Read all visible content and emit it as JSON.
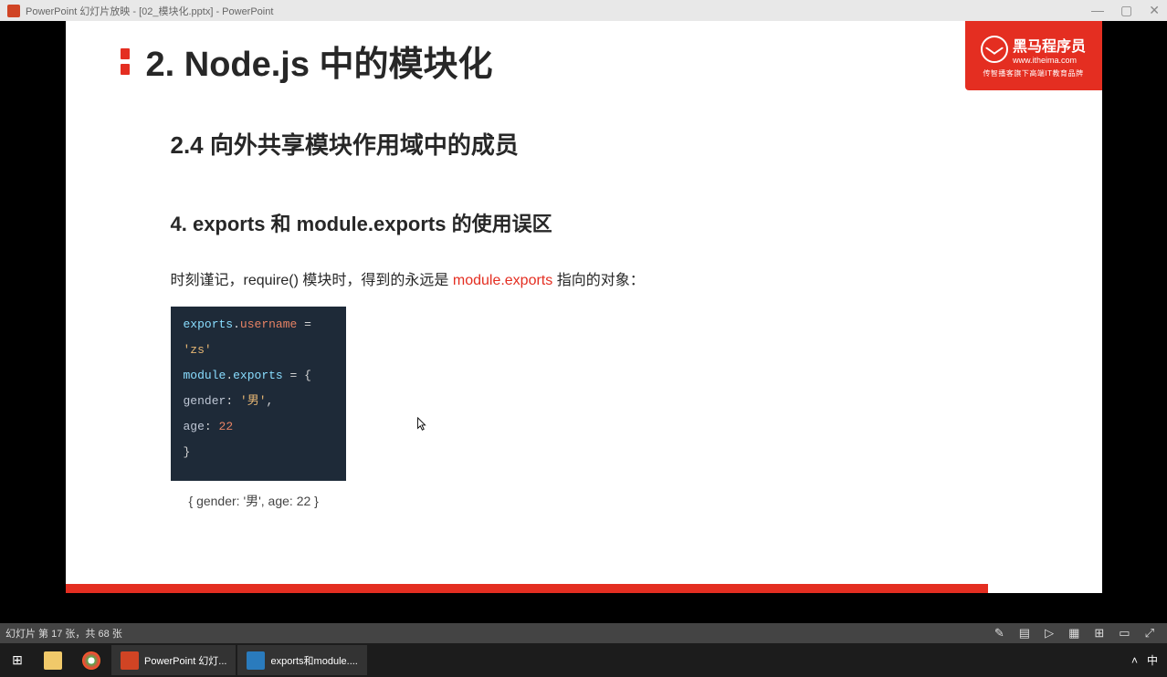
{
  "window": {
    "title": "PowerPoint 幻灯片放映  - [02_模块化.pptx] - PowerPoint",
    "controls": {
      "min": "—",
      "restore": "▢",
      "close": "✕"
    }
  },
  "slide": {
    "brand": {
      "name": "黑马程序员",
      "url": "www.itheima.com",
      "slogan": "传智播客旗下高端IT教育品牌"
    },
    "h1": "2. Node.js 中的模块化",
    "h2": "2.4 向外共享模块作用域中的成员",
    "h3": "4. exports 和 module.exports 的使用误区",
    "body_pre": "时刻谨记，require() 模块时，得到的永远是 ",
    "body_highlight": "module.exports",
    "body_post": " 指向的对象：",
    "code": {
      "l1a": "exports",
      "l1b": ".",
      "l1c": "username",
      "l1d": " = ",
      "l1e": "'zs'",
      "l2a": "module",
      "l2b": ".",
      "l2c": "exports",
      "l2d": " = {",
      "l3a": "  gender",
      "l3b": ": ",
      "l3c": "'男'",
      "l3d": ",",
      "l4a": "  age",
      "l4b": ": ",
      "l4c": "22",
      "l5": "}"
    },
    "output": "{ gender: '男', age: 22 }"
  },
  "statusbar": {
    "slide_info": "幻灯片 第 17 张，共 68 张"
  },
  "taskbar": {
    "app1": "PowerPoint 幻灯...",
    "app2": "exports和module....",
    "ime": "中"
  }
}
